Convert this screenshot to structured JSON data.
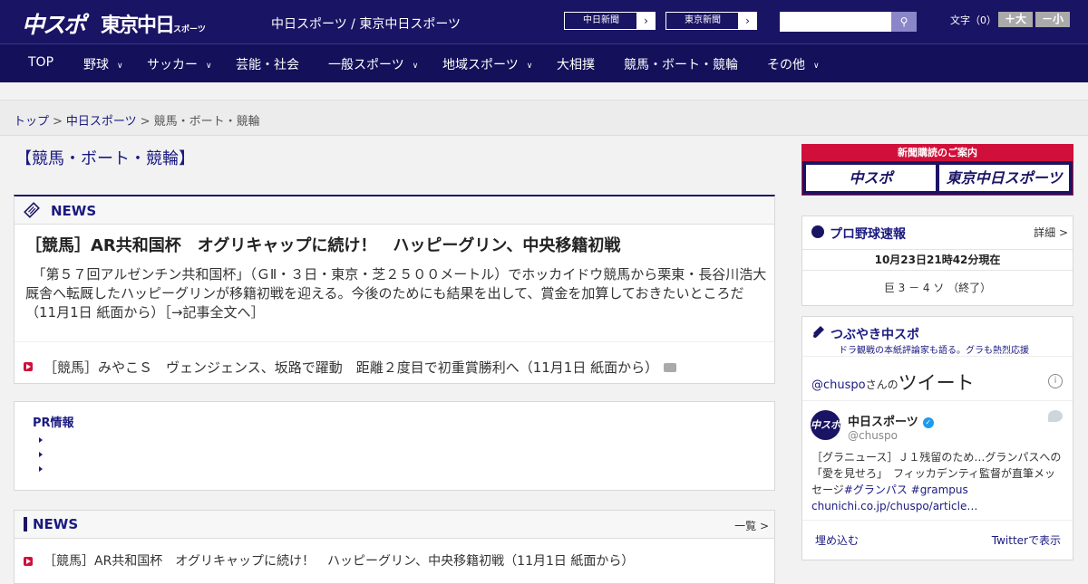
{
  "header": {
    "logo_chuspo": "中スポ",
    "logo_tokyo": "東京中日",
    "logo_tokyo_sub": "スポーツ",
    "site_title": "中日スポーツ / 東京中日スポーツ",
    "btn_chunichi": "中日新聞",
    "btn_tokyo": "東京新聞",
    "search_placeholder": "",
    "font_size_label": "文字（0）",
    "font_big": "＋大",
    "font_small": "－小"
  },
  "nav": [
    {
      "label": "TOP",
      "dropdown": false
    },
    {
      "label": "野球",
      "dropdown": true
    },
    {
      "label": "サッカー",
      "dropdown": true
    },
    {
      "label": "芸能・社会",
      "dropdown": false
    },
    {
      "label": "一般スポーツ",
      "dropdown": true
    },
    {
      "label": "地域スポーツ",
      "dropdown": true
    },
    {
      "label": "大相撲",
      "dropdown": false
    },
    {
      "label": "競馬・ボート・競輪",
      "dropdown": false
    },
    {
      "label": "その他",
      "dropdown": true
    }
  ],
  "breadcrumb": {
    "items": [
      "トップ",
      "中日スポーツ",
      "競馬・ボート・競輪"
    ],
    "separator": ">"
  },
  "page_title": "【競馬・ボート・競輪】",
  "news_top": {
    "header": "NEWS",
    "lead_title": "［競馬］AR共和国杯　オグリキャップに続け！　ハッピーグリン、中央移籍初戦",
    "lead_body": "　「第５７回アルゼンチン共和国杯」（ＧⅡ・３日・東京・芝２５００メートル）でホッカイドウ競馬から栗東・長谷川浩大厩舎へ転厩したハッピーグリンが移籍初戦を迎える。今後のためにも結果を出して、賞金を加算しておきたいところだ（11月1日 紙面から）［→記事全文へ］",
    "item": "［競馬］みやこＳ　ヴェンジェンス、坂路で躍動　距離２度目で初重賞勝利へ（11月1日 紙面から）"
  },
  "pr": {
    "title": "PR情報"
  },
  "news_list": {
    "header": "NEWS",
    "more": "一覧 >",
    "items": [
      "［競馬］AR共和国杯　オグリキャップに続け！　ハッピーグリン、中央移籍初戦（11月1日 紙面から）"
    ]
  },
  "sidebar": {
    "subscribe_top": "新聞購読のご案内",
    "subscribe_chuspo": "中スポ",
    "subscribe_tokyo": "東京中日スポーツ",
    "baseball": {
      "title": "プロ野球速報",
      "more": "詳細 >",
      "time": "10月23日21時42分現在",
      "score": "巨 3 － 4 ソ （終了）"
    },
    "twitter": {
      "title": "つぶやき中スポ",
      "subtitle": "ドラ観戦の本紙評論家も語る。グラも熱烈応援",
      "handle_prefix": "@chuspo",
      "handle_suffix": "さんの",
      "tweet_word": "ツイート",
      "account_name": "中日スポーツ",
      "account_handle": "@chuspo",
      "tweet_text": "［グラニュース］Ｊ１残留のため…グランパスへの「愛を見せろ」　フィッカデンティ監督が直筆メッセージ",
      "tweet_tags": "#グランパス #grampus",
      "tweet_link": "chunichi.co.jp/chuspo/article…",
      "embed": "埋め込む",
      "view": "Twitterで表示"
    }
  },
  "colors": {
    "brand_navy": "#1a1464",
    "accent_red": "#d0103a"
  }
}
